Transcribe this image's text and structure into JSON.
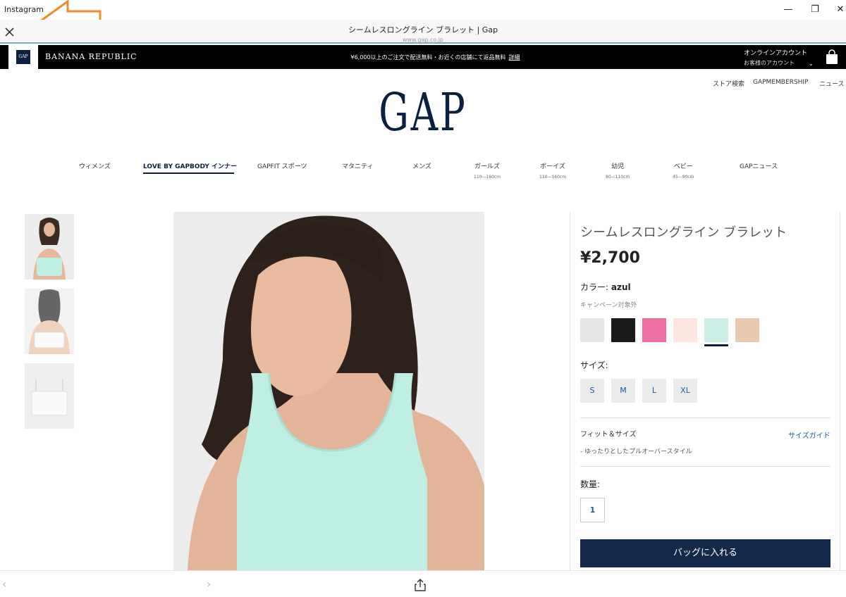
{
  "window": {
    "app_title": "Instagram",
    "min_glyph": "—",
    "max_glyph": "❐",
    "close_glyph": "✕"
  },
  "browser": {
    "title": "シームレスロングライン ブラレット | Gap",
    "url": "www.gap.co.jp"
  },
  "brandbar": {
    "gap_mini_logo": "GAP",
    "banana_republic": "BANANA REPUBLIC",
    "promo_text": "¥6,000以上のご注文で配送無料・お近くの店舗にて返品無料",
    "promo_link": "詳細",
    "account_title": "オンラインアカウント",
    "account_sub": "お客様のアカウント",
    "account_chevron": "⌄"
  },
  "utility": {
    "store": "ストア検索",
    "membership": "GAPMEMBERSHIP",
    "news": "ニュース"
  },
  "logo": "GAP",
  "nav": [
    {
      "label": "ウィメンズ",
      "sub": ""
    },
    {
      "label": "LOVE BY GAPBODY インナー",
      "sub": ""
    },
    {
      "label": "GAPFIT スポーツ",
      "sub": ""
    },
    {
      "label": "マタニティ",
      "sub": ""
    },
    {
      "label": "メンズ",
      "sub": ""
    },
    {
      "label": "ガールズ",
      "sub": "110—160cm"
    },
    {
      "label": "ボーイズ",
      "sub": "110—160cm"
    },
    {
      "label": "幼児",
      "sub": "80—110cm"
    },
    {
      "label": "ベビー",
      "sub": "45—90cm"
    },
    {
      "label": "GAPニュース",
      "sub": ""
    }
  ],
  "product": {
    "title": "シームレスロングライン ブラレット",
    "price": "¥2,700",
    "color_prefix": "カラー: ",
    "color_name": "azul",
    "campaign": "キャンペーン対象外",
    "swatches": [
      "#e6e6e6",
      "#1a1a1a",
      "#f06fa3",
      "#fde6df",
      "#cdeee6",
      "#e9c9ad"
    ],
    "selected_swatch_index": 4,
    "size_label": "サイズ:",
    "sizes": [
      "S",
      "M",
      "L",
      "XL"
    ],
    "fit_label": "フィット＆サイズ",
    "size_guide": "サイズガイド",
    "fit_detail": "- ゆったりとしたプルオーバースタイル",
    "qty_label": "数量:",
    "qty_value": "1",
    "add_to_bag": "バッグに入れる"
  },
  "bottom": {
    "back": "‹",
    "forward": "›"
  },
  "colors": {
    "navy": "#0b1f3f",
    "button": "#13294b",
    "link": "#1f5aa0",
    "mint": "#bfeee2",
    "annotation": "#f08a2e"
  }
}
